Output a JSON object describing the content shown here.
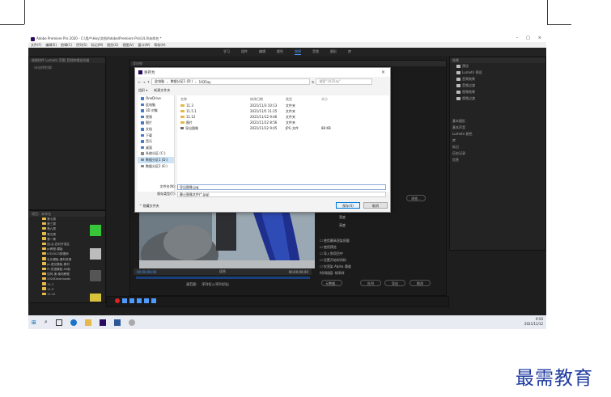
{
  "window": {
    "title": "Adobe Premiere Pro 2020 - C:\\用户\\Hoy\\文档\\Adobe\\Premiere Pro\\14.0\\未命名 *",
    "controls": [
      "–",
      "□",
      "×"
    ]
  },
  "menubar": [
    "文件(F)",
    "编辑(E)",
    "剪辑(C)",
    "序列(S)",
    "标记(M)",
    "图形(G)",
    "视图(V)",
    "窗口(W)",
    "帮助(H)"
  ],
  "workspace_tabs": [
    {
      "label": "学习",
      "active": false
    },
    {
      "label": "组件",
      "active": false
    },
    {
      "label": "编辑",
      "active": false
    },
    {
      "label": "颜色",
      "active": false
    },
    {
      "label": "效果",
      "active": true
    },
    {
      "label": "音频",
      "active": false
    },
    {
      "label": "图形",
      "active": false
    },
    {
      "label": "库",
      "active": false
    }
  ],
  "left_panel": {
    "header": "源：(无剪辑)",
    "tabs": "效果控件  Lumetri 范围  音频剪辑混合器",
    "empty": "（未选择剪辑）"
  },
  "effects_panel": {
    "header": "效果",
    "items": [
      "预设",
      "Lumetri 预设",
      "音频效果",
      "音频过渡",
      "视频效果",
      "视频过渡"
    ],
    "side_items": [
      "基本图形",
      "基本声音",
      "Lumetri 颜色",
      "库",
      "标记",
      "历史记录",
      "信息"
    ]
  },
  "project_panel": {
    "header": "项目：未命名",
    "bins": [
      "第七周",
      "第三周",
      "第六周",
      "第五周",
      "第一周",
      "如-点-四月开发区",
      "pr教程-模板",
      "LYD2023剪辑师",
      "礼乐模板-素材资源",
      "pr-提交模板-素材",
      "Pr-双语模板-4K版",
      "如何-速-使用教程",
      "2020Downloads",
      "11.1",
      "11.3",
      "11.12"
    ]
  },
  "dialog": {
    "title": "另存为",
    "address": [
      "此电脑",
      "数据分区1 (D:)",
      "1935ay"
    ],
    "search_placeholder": "搜索\"1935ay\"",
    "toolbar": {
      "organize": "组织 ▾",
      "new_folder": "新建文件夹"
    },
    "nav": [
      "OneDrive",
      "此电脑",
      "3D 对象",
      "视频",
      "图片",
      "文档",
      "下载",
      "音乐",
      "桌面",
      "系统分区 (C:)",
      "数据分区1 (D:)",
      "数据分区2 (E:)"
    ],
    "columns": [
      "名称",
      "修改日期",
      "类型",
      "大小"
    ],
    "files": [
      {
        "name": "11.3",
        "date": "2021/11/3 10:13",
        "type": "文件夹",
        "size": ""
      },
      {
        "name": "11.5.1",
        "date": "2021/11/5 11:25",
        "type": "文件夹",
        "size": ""
      },
      {
        "name": "11.12",
        "date": "2021/11/12 9:46",
        "type": "文件夹",
        "size": ""
      },
      {
        "name": "图片",
        "date": "2021/11/12 8:56",
        "type": "文件夹",
        "size": ""
      },
      {
        "name": "导出图像",
        "date": "2021/11/12 9:45",
        "type": "JPG 文件",
        "size": "88 KB"
      }
    ],
    "filename_label": "文件名(N):",
    "filename_value": "导出图像.jpg",
    "filetype_label": "保存类型(T):",
    "filetype_value": "静止图像文件(*.jpg)",
    "hide_folders": "隐藏文件夹",
    "save": "保存(S)",
    "cancel": "取消"
  },
  "export_panel": {
    "header": "导出帧",
    "width_label": "宽度",
    "height_label": "高度",
    "options": [
      "使用最高渲染质量",
      "使用预览",
      "导入到项目中",
      "设置开始时间码",
      "仅渲染 Alpha 通道"
    ],
    "time_interp_label": "时间插值:",
    "time_interp_value": "帧采样",
    "buttons": {
      "metadata": "元数据...",
      "queue": "队列",
      "export": "导出",
      "cancel": "取消"
    },
    "browse_button": "浏览..."
  },
  "program_monitor": {
    "timecode_left": "00;00;00;00",
    "timecode_right": "00;00;00;00",
    "fit": "适合",
    "source_range_label": "源范围:",
    "source_range_value": "序列切入/序列切出"
  },
  "taskbar": {
    "time": "9:50",
    "date": "2021/11/12"
  },
  "watermark": "最需教育"
}
